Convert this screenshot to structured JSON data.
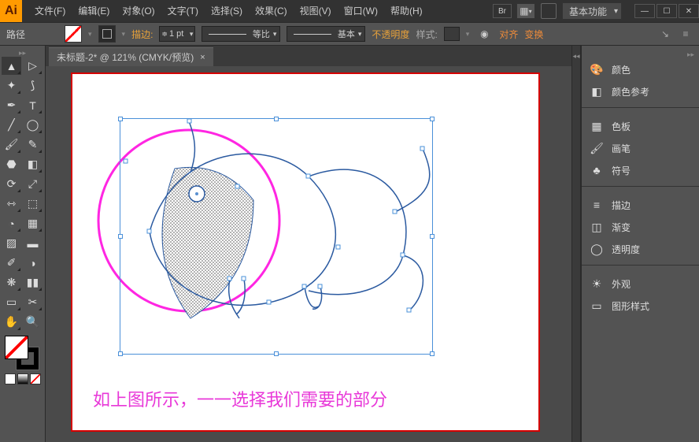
{
  "app": {
    "logo": "Ai"
  },
  "menu": {
    "file": "文件(F)",
    "edit": "编辑(E)",
    "object": "对象(O)",
    "type": "文字(T)",
    "select": "选择(S)",
    "effect": "效果(C)",
    "view": "视图(V)",
    "window": "窗口(W)",
    "help": "帮助(H)"
  },
  "workspace_sel": "基本功能",
  "ctrl": {
    "label": "路径",
    "stroke_label": "描边:",
    "stroke_weight": "1 pt",
    "profile": "等比",
    "brush": "基本",
    "opacity": "不透明度",
    "style": "样式:",
    "align": "对齐",
    "transform": "变换"
  },
  "doc_tab": "未标题-2* @ 121% (CMYK/预览)",
  "caption": "如上图所示，一一选择我们需要的部分",
  "panels": {
    "color": "颜色",
    "color_guide": "颜色参考",
    "swatches": "色板",
    "brushes": "画笔",
    "symbols": "符号",
    "stroke": "描边",
    "gradient": "渐变",
    "transparency": "透明度",
    "appearance": "外观",
    "graphic_styles": "图形样式"
  },
  "tools": {
    "selection": "selection",
    "direct": "direct-selection",
    "wand": "magic-wand",
    "lasso": "lasso",
    "pen": "pen",
    "type": "type",
    "line": "line",
    "ellipse": "ellipse",
    "brush": "paintbrush",
    "pencil": "pencil",
    "blob": "blob-brush",
    "eraser": "eraser",
    "rotate": "rotate",
    "scale": "scale",
    "width": "width",
    "warp": "free-transform",
    "shapebuilder": "shape-builder",
    "perspective": "live-paint",
    "mesh": "mesh",
    "gradient": "gradient",
    "eyedrop": "eyedropper",
    "blend": "blend",
    "spray": "symbol-sprayer",
    "graph": "column-graph",
    "artboard": "artboard",
    "slice": "slice",
    "hand": "hand",
    "zoom": "zoom"
  }
}
